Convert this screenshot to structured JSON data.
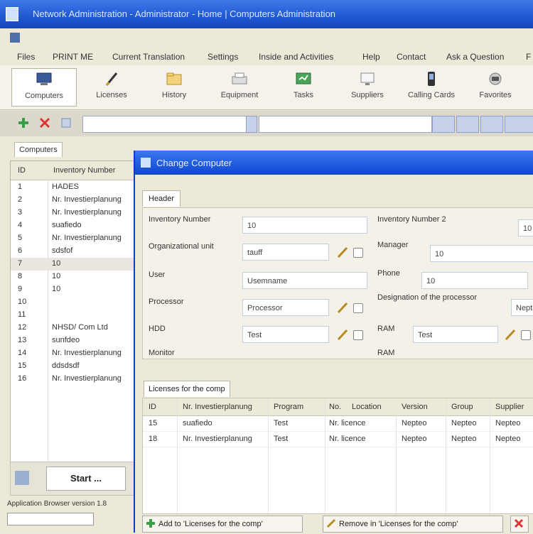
{
  "window": {
    "title": "Network Administration - Administrator - Home | Computers Administration"
  },
  "menu": [
    "Files",
    "PRINT ME",
    "Current Translation",
    "Settings",
    "Inside and Activities",
    "Help",
    "Contact",
    "Ask a Question",
    "F"
  ],
  "toolbar": [
    {
      "label": "Computers",
      "icon": "computers-icon",
      "active": true
    },
    {
      "label": "Licenses",
      "icon": "pencil-icon"
    },
    {
      "label": "History",
      "icon": "folder-icon"
    },
    {
      "label": "Equipment",
      "icon": "printer-icon"
    },
    {
      "label": "Tasks",
      "icon": "board-icon"
    },
    {
      "label": "Suppliers",
      "icon": "monitor-icon"
    },
    {
      "label": "Calling Cards",
      "icon": "phone-icon"
    },
    {
      "label": "Favorites",
      "icon": "star-icon"
    }
  ],
  "left_tab": "Computers",
  "left_panel": {
    "headers": [
      "ID",
      "Inventory Number"
    ],
    "rows": [
      [
        "1",
        "HADES"
      ],
      [
        "2",
        "Nr. Investierplanung"
      ],
      [
        "3",
        "Nr. Investierplanung"
      ],
      [
        "4",
        "suafiedo"
      ],
      [
        "5",
        "Nr. Investierplanung"
      ],
      [
        "6",
        "sdsfof"
      ],
      [
        "7",
        "10"
      ],
      [
        "8",
        "10"
      ],
      [
        "9",
        "10"
      ],
      [
        "10",
        ""
      ],
      [
        "11",
        ""
      ],
      [
        "12",
        "NHSD/ Com Ltd"
      ],
      [
        "13",
        "sunfdeo"
      ],
      [
        "14",
        "Nr. Investierplanung"
      ],
      [
        "15",
        "ddsdsdf"
      ],
      [
        "16",
        "Nr. Investierplanung"
      ]
    ]
  },
  "start_button": "Start ...",
  "status": {
    "text": "Application Browser version 1.8"
  },
  "dialog": {
    "title": "Change Computer",
    "tab": "Header",
    "fields": {
      "inventory_number": {
        "label": "Inventory Number",
        "value": "10"
      },
      "inventory_number_2": {
        "label": "Inventory Number 2",
        "value": "10"
      },
      "organizational_unit": {
        "label": "Organizational unit",
        "value": "tauff"
      },
      "manager": {
        "label": "Manager",
        "value": "10"
      },
      "user": {
        "label": "User",
        "value": "Usemname"
      },
      "phone": {
        "label": "Phone",
        "value": "10"
      },
      "processor": {
        "label": "Processor",
        "value": "Processor"
      },
      "processor_designation": {
        "label": "Designation of the processor",
        "value": "Nepte"
      },
      "hdd": {
        "label": "HDD",
        "value": "Test"
      },
      "ram": {
        "label": "RAM",
        "value": "Test"
      },
      "monitor": {
        "label": "Monitor"
      },
      "extra": {
        "label": "RAM"
      }
    },
    "sub_tab": "Licenses for the comp",
    "grid": {
      "headers": [
        "ID",
        "Nr. Investierplanung",
        "Program",
        "No.",
        "Location",
        "Version",
        "Group",
        "Supplier"
      ],
      "rows": [
        [
          "15",
          "suafiedo",
          "Test",
          "Nr. licence",
          "Nepteo",
          "Nepteo",
          "Nepteo",
          ""
        ],
        [
          "18",
          "Nr. Investierplanung",
          "Test",
          "Nr. licence",
          "Nepteo",
          "Nepteo",
          "Nepteo",
          ""
        ]
      ]
    },
    "buttons": {
      "add": "Add to 'Licenses for the comp'",
      "remove": "Remove in 'Licenses for the comp'"
    }
  },
  "colors": {
    "accent": "#1f58d3",
    "dialog_title": "#1e5ae0"
  }
}
